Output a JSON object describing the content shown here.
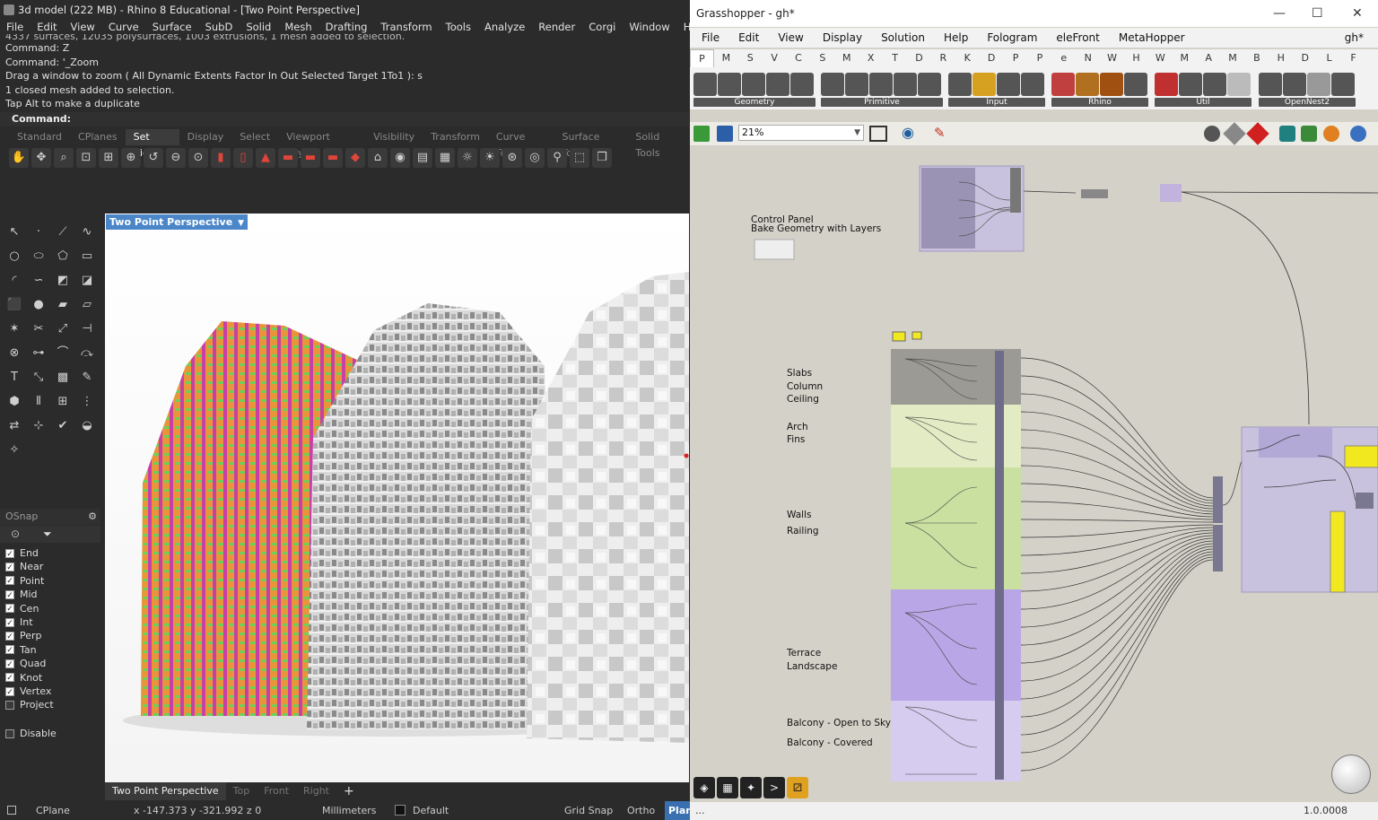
{
  "rhino": {
    "title": "3d model (222 MB) - Rhino 8 Educational - [Two Point Perspective]",
    "menu": [
      "File",
      "Edit",
      "View",
      "Curve",
      "Surface",
      "SubD",
      "Solid",
      "Mesh",
      "Drafting",
      "Transform",
      "Tools",
      "Analyze",
      "Render",
      "Corgi",
      "Window",
      "Help"
    ],
    "command_history": [
      "4337 surfaces, 12035 polysurfaces, 1003 extrusions, 1 mesh added to selection.",
      "Command: Z",
      "Command: '_Zoom",
      "Drag a window to zoom ( All  Dynamic  Extents  Factor  In  Out  Selected  Target  1To1 ): s",
      "1 closed mesh added to selection.",
      "Tap Alt to make a duplicate"
    ],
    "command_prompt": "Command:",
    "toolbar_tabs": [
      "Standard",
      "CPlanes",
      "Set View",
      "Display",
      "Select",
      "Viewport Layout",
      "Visibility",
      "Transform",
      "Curve Tools",
      "Surface Tools",
      "Solid Tools"
    ],
    "active_toolbar_tab": "Set View",
    "viewport_title": "Two Point Perspective",
    "viewport_tabs": [
      "Two Point Perspective",
      "Top",
      "Front",
      "Right"
    ],
    "add_tab_symbol": "+",
    "osnap": {
      "header": "OSnap",
      "items": [
        {
          "label": "End",
          "checked": true
        },
        {
          "label": "Near",
          "checked": true
        },
        {
          "label": "Point",
          "checked": true
        },
        {
          "label": "Mid",
          "checked": true
        },
        {
          "label": "Cen",
          "checked": true
        },
        {
          "label": "Int",
          "checked": true
        },
        {
          "label": "Perp",
          "checked": true
        },
        {
          "label": "Tan",
          "checked": true
        },
        {
          "label": "Quad",
          "checked": true
        },
        {
          "label": "Knot",
          "checked": true
        },
        {
          "label": "Vertex",
          "checked": true
        },
        {
          "label": "Project",
          "checked": false
        }
      ],
      "disable": {
        "label": "Disable",
        "checked": false
      }
    },
    "status": {
      "cplane": "CPlane",
      "coords": "x -147.373  y -321.992  z 0",
      "units": "Millimeters",
      "layer": "Default",
      "grid_snap": "Grid Snap",
      "ortho": "Ortho",
      "planar": "Plan"
    }
  },
  "grasshopper": {
    "title": "Grasshopper - gh*",
    "window_controls": [
      "—",
      "☐",
      "✕"
    ],
    "menu": [
      "File",
      "Edit",
      "View",
      "Display",
      "Solution",
      "Help",
      "Fologram",
      "eleFront",
      "MetaHopper"
    ],
    "doc_name": "gh*",
    "component_tabs": [
      "P",
      "M",
      "S",
      "V",
      "C",
      "S",
      "M",
      "X",
      "T",
      "D",
      "R",
      "K",
      "D",
      "P",
      "P",
      "e",
      "N",
      "W",
      "H",
      "W",
      "M",
      "A",
      "M",
      "B",
      "H",
      "D",
      "L",
      "F"
    ],
    "active_component_tab": "P",
    "component_groups": [
      "Geometry",
      "Primitive",
      "Input",
      "Rhino",
      "Util",
      "OpenNest2"
    ],
    "zoom": "21%",
    "canvas_labels": {
      "control_panel": "Control Panel",
      "bake_geometry": "Bake Geometry with Layers",
      "group1": [
        "Slabs",
        "Column",
        "Ceiling"
      ],
      "group2": [
        "Arch",
        "Fins"
      ],
      "group3": [
        "Walls",
        "Railing"
      ],
      "group4": [
        "Terrace",
        "Landscape"
      ],
      "group5": [
        "Balcony - Open to Sky",
        "Balcony - Covered"
      ]
    },
    "status_left": "...",
    "version": "1.0.0008"
  },
  "colors": {
    "vp_label_bg": "#4a86c8",
    "building_orange": "#e8953a",
    "building_magenta": "#c83fa8",
    "building_green": "#6fcf5a",
    "group_gray": "#9c9a95",
    "group_lightgreen": "#e2ebc4",
    "group_green": "#c9e0a0",
    "group_purple": "#b9a6e6",
    "group_lightpurple": "#d6ccef"
  }
}
